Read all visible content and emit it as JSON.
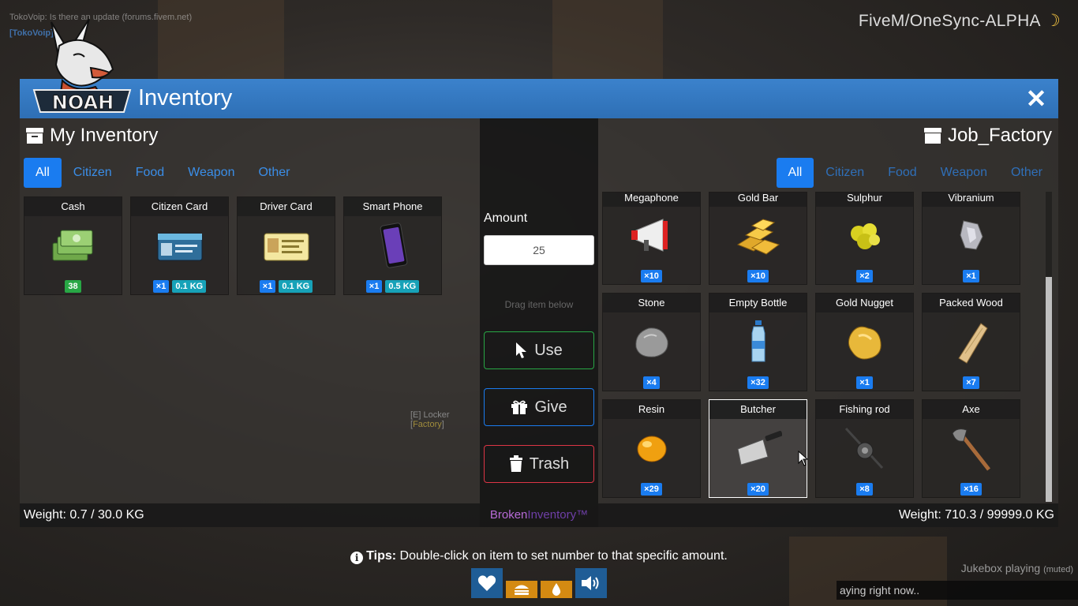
{
  "server_name": "FiveM/OneSync-ALPHA",
  "chat": {
    "line1": "TokoVoip: Is there an update (forums.fivem.net)",
    "line2": "[TokoVoip]"
  },
  "window": {
    "title": "Inventory",
    "close_label": "✕",
    "logo_text": "NOAH"
  },
  "left": {
    "header": "My Inventory",
    "tabs": [
      "All",
      "Citizen",
      "Food",
      "Weapon",
      "Other"
    ],
    "items": [
      {
        "name": "Cash",
        "count": "38",
        "weight": ""
      },
      {
        "name": "Citizen Card",
        "count": "×1",
        "weight": "0.1 KG"
      },
      {
        "name": "Driver Card",
        "count": "×1",
        "weight": "0.1 KG"
      },
      {
        "name": "Smart Phone",
        "count": "×1",
        "weight": "0.5 KG"
      }
    ],
    "locker_hint_a": "[E] Locker [",
    "locker_hint_b": "Factory",
    "locker_hint_c": "]",
    "weight": "Weight: 0.7 / 30.0 KG"
  },
  "middle": {
    "amount_label": "Amount",
    "amount_value": "25",
    "drag_hint": "Drag item below",
    "use_label": "Use",
    "give_label": "Give",
    "trash_label": "Trash",
    "brand_a": "Broken",
    "brand_b": "Inventory™"
  },
  "right": {
    "header": "Job_Factory",
    "tabs": [
      "All",
      "Citizen",
      "Food",
      "Weapon",
      "Other"
    ],
    "items": [
      {
        "name": "Megaphone",
        "count": "×10"
      },
      {
        "name": "Gold Bar",
        "count": "×10"
      },
      {
        "name": "Sulphur",
        "count": "×2"
      },
      {
        "name": "Vibranium",
        "count": "×1"
      },
      {
        "name": "Stone",
        "count": "×4"
      },
      {
        "name": "Empty Bottle",
        "count": "×32"
      },
      {
        "name": "Gold Nugget",
        "count": "×1"
      },
      {
        "name": "Packed Wood",
        "count": "×7"
      },
      {
        "name": "Resin",
        "count": "×29"
      },
      {
        "name": "Butcher",
        "count": "×20"
      },
      {
        "name": "Fishing rod",
        "count": "×8"
      },
      {
        "name": "Axe",
        "count": "×16"
      }
    ],
    "weight": "Weight: 710.3 / 99999.0 KG"
  },
  "tips": {
    "bold": "Tips:",
    "text": " Double-click on item to set number to that specific amount."
  },
  "jukebox": {
    "label": "Jukebox playing",
    "muted": "(muted)",
    "now": "aying right now.."
  },
  "colors": {
    "titlebar": "#3b82cc",
    "tab_active": "#1a7cf0",
    "use_border": "#28a745",
    "give_border": "#1a7cf0",
    "trash_border": "#dc3545"
  }
}
